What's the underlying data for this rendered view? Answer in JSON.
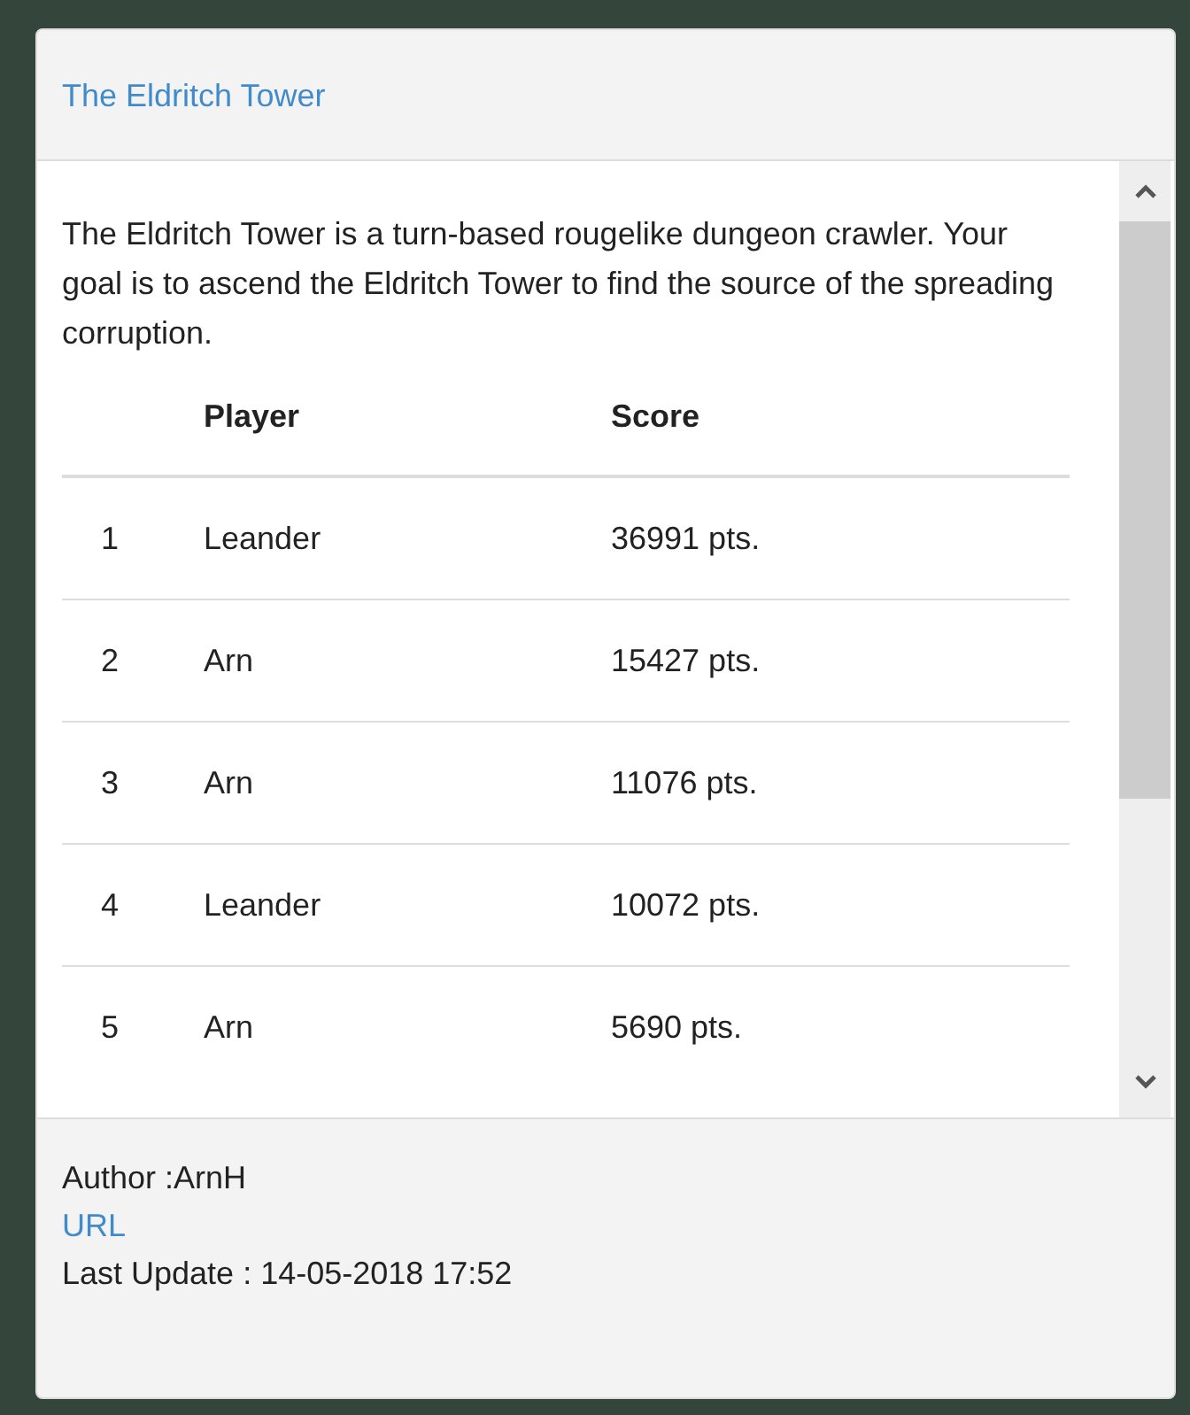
{
  "panel": {
    "title": "The Eldritch Tower"
  },
  "description": "The Eldritch Tower is a turn-based rougelike dungeon crawler. Your goal is to ascend the Eldritch Tower to find the source of the spreading corruption.",
  "table": {
    "columns": [
      "",
      "Player",
      "Score"
    ],
    "rows": [
      {
        "rank": "1",
        "player": "Leander",
        "score": "36991 pts."
      },
      {
        "rank": "2",
        "player": "Arn",
        "score": "15427 pts."
      },
      {
        "rank": "3",
        "player": "Arn",
        "score": "11076 pts."
      },
      {
        "rank": "4",
        "player": "Leander",
        "score": "10072 pts."
      },
      {
        "rank": "5",
        "player": "Arn",
        "score": "5690 pts."
      }
    ]
  },
  "footer": {
    "author": "Author :ArnH",
    "link": "URL",
    "last_update": "Last Update : 14-05-2018 17:52"
  }
}
